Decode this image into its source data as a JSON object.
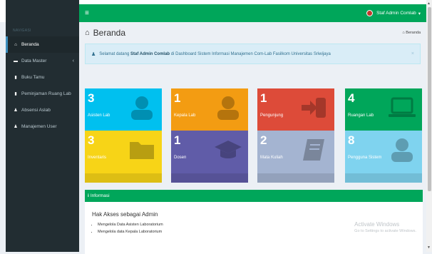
{
  "header": {
    "menu_icon": "hamburger-icon",
    "user_name": "Staf Admin Comlab",
    "user_caret": "▾"
  },
  "sidebar": {
    "heading": "NAVIGASI",
    "items": [
      {
        "label": "Beranda",
        "icon": "home-icon",
        "glyph": "⌂"
      },
      {
        "label": "Data Master",
        "icon": "folder-icon",
        "glyph": "▬",
        "chevron": "‹"
      },
      {
        "label": "Buku Tamu",
        "icon": "book-icon",
        "glyph": "▮"
      },
      {
        "label": "Peminjaman Ruang Lab",
        "icon": "file-icon",
        "glyph": "▮"
      },
      {
        "label": "Absensi Aslab",
        "icon": "user-icon",
        "glyph": "♟"
      },
      {
        "label": "Manajemen User",
        "icon": "user-icon",
        "glyph": "♟"
      }
    ]
  },
  "page": {
    "title": "Beranda",
    "title_icon": "home-icon",
    "breadcrumb": "Beranda"
  },
  "alert": {
    "prefix": "Selamat datang ",
    "user": "Staf Admin Comlab",
    "suffix": " di Dashboard Sistem Informasi Manajemen Com-Lab Fasilkom Universitas Sriwijaya",
    "close": "×"
  },
  "stats": [
    {
      "value": "3",
      "label": "Asisten Lab",
      "icon": "user-icon",
      "color": "#00c0ef"
    },
    {
      "value": "1",
      "label": "Kepala Lab",
      "icon": "user-icon",
      "color": "#f39c12"
    },
    {
      "value": "1",
      "label": "Pengunjung",
      "icon": "sign-in-icon",
      "color": "#dd4b39"
    },
    {
      "value": "4",
      "label": "Ruangan Lab",
      "icon": "laptop-icon",
      "color": "#00a65a"
    },
    {
      "value": "3",
      "label": "Inventaris",
      "icon": "folder-icon",
      "color": "#f7d417"
    },
    {
      "value": "1",
      "label": "Dosen",
      "icon": "graduation-cap-icon",
      "color": "#605ca8"
    },
    {
      "value": "2",
      "label": "Mata Kuliah",
      "icon": "book-icon",
      "color": "#a4b4d1"
    },
    {
      "value": "8",
      "label": "Pengguna Sistem",
      "icon": "user-icon",
      "color": "#7fd3ef"
    }
  ],
  "info": {
    "header": "Informasi",
    "heading": "Hak Akses sebagai Admin",
    "items": [
      "Mengelola Data Asisten Laboratorium",
      "Mengelola data Kepala Laboratorium"
    ]
  },
  "watermark": {
    "line1": "Activate Windows",
    "line2": "Go to Settings to activate Windows."
  }
}
